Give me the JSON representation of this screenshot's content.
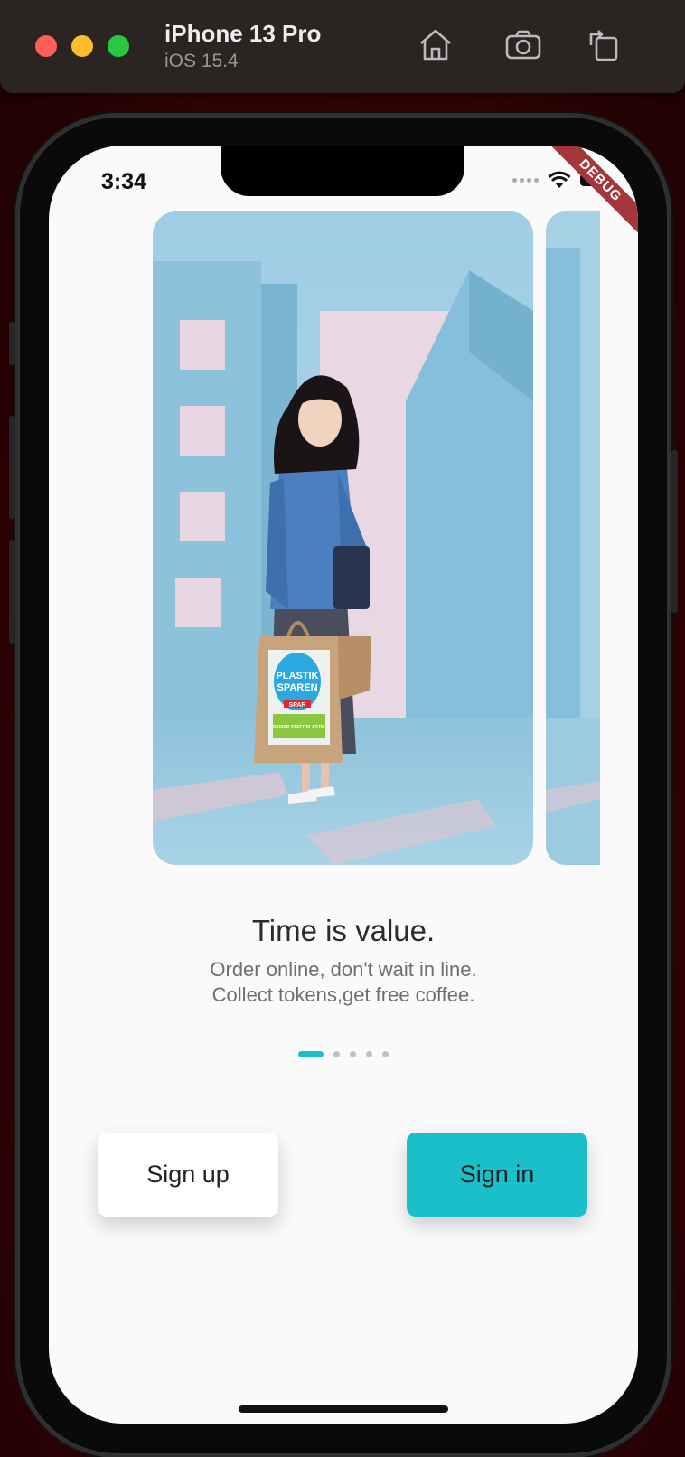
{
  "simulator": {
    "device_name": "iPhone 13 Pro",
    "os_version": "iOS 15.4"
  },
  "status_bar": {
    "time": "3:34"
  },
  "debug_banner": "DEBUG",
  "onboarding": {
    "title": "Time is value.",
    "subtitle_line1": "Order online, don't wait in line.",
    "subtitle_line2": "Collect tokens,get free coffee.",
    "page_count": 5,
    "current_page": 1,
    "bag_text_1": "PLASTIK",
    "bag_text_2": "SPAREN",
    "bag_brand": "SPAR",
    "bag_text_3": "PAPIER STATT PLASTIK"
  },
  "buttons": {
    "sign_up": "Sign up",
    "sign_in": "Sign in"
  },
  "colors": {
    "accent": "#1bbfc9",
    "card_bg": "#a9d4e8"
  }
}
